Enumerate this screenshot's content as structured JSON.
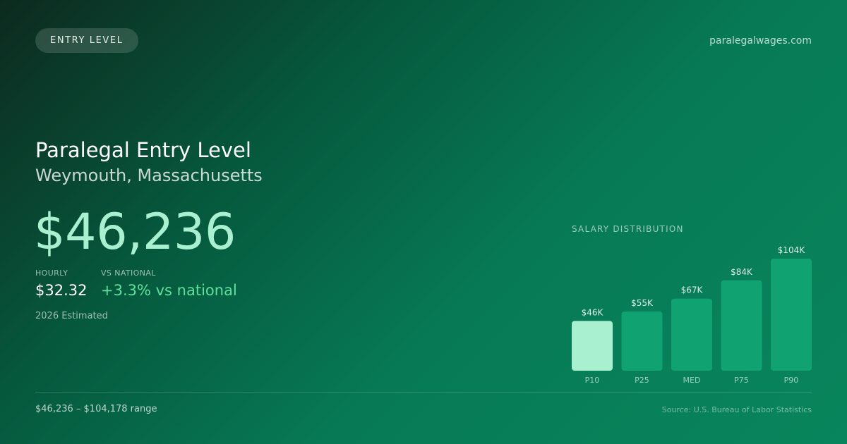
{
  "badge": "ENTRY LEVEL",
  "site": "paralegalwages.com",
  "title": "Paralegal Entry Level",
  "subtitle": "Weymouth, Massachusetts",
  "salary": "$46,236",
  "stats": {
    "hourly_label": "HOURLY",
    "hourly_value": "$32.32",
    "national_label": "VS NATIONAL",
    "national_value": "+3.3% vs national"
  },
  "estimated": "2026 Estimated",
  "range": "$46,236 – $104,178 range",
  "source": "Source: U.S. Bureau of Labor Statistics",
  "chart_title": "SALARY DISTRIBUTION",
  "colors": {
    "highlight_bar": "#a8f0cf",
    "bar": "#10a371",
    "salary_text": "#a8f0cf",
    "positive_text": "#5fe09a"
  },
  "chart_data": {
    "type": "bar",
    "title": "SALARY DISTRIBUTION",
    "categories": [
      "P10",
      "P25",
      "MED",
      "P75",
      "P90"
    ],
    "values": [
      46236,
      55000,
      67000,
      84000,
      104178
    ],
    "value_labels": [
      "$46K",
      "$55K",
      "$67K",
      "$84K",
      "$104K"
    ],
    "highlight_index": 0,
    "grid": false,
    "legend": "none"
  }
}
